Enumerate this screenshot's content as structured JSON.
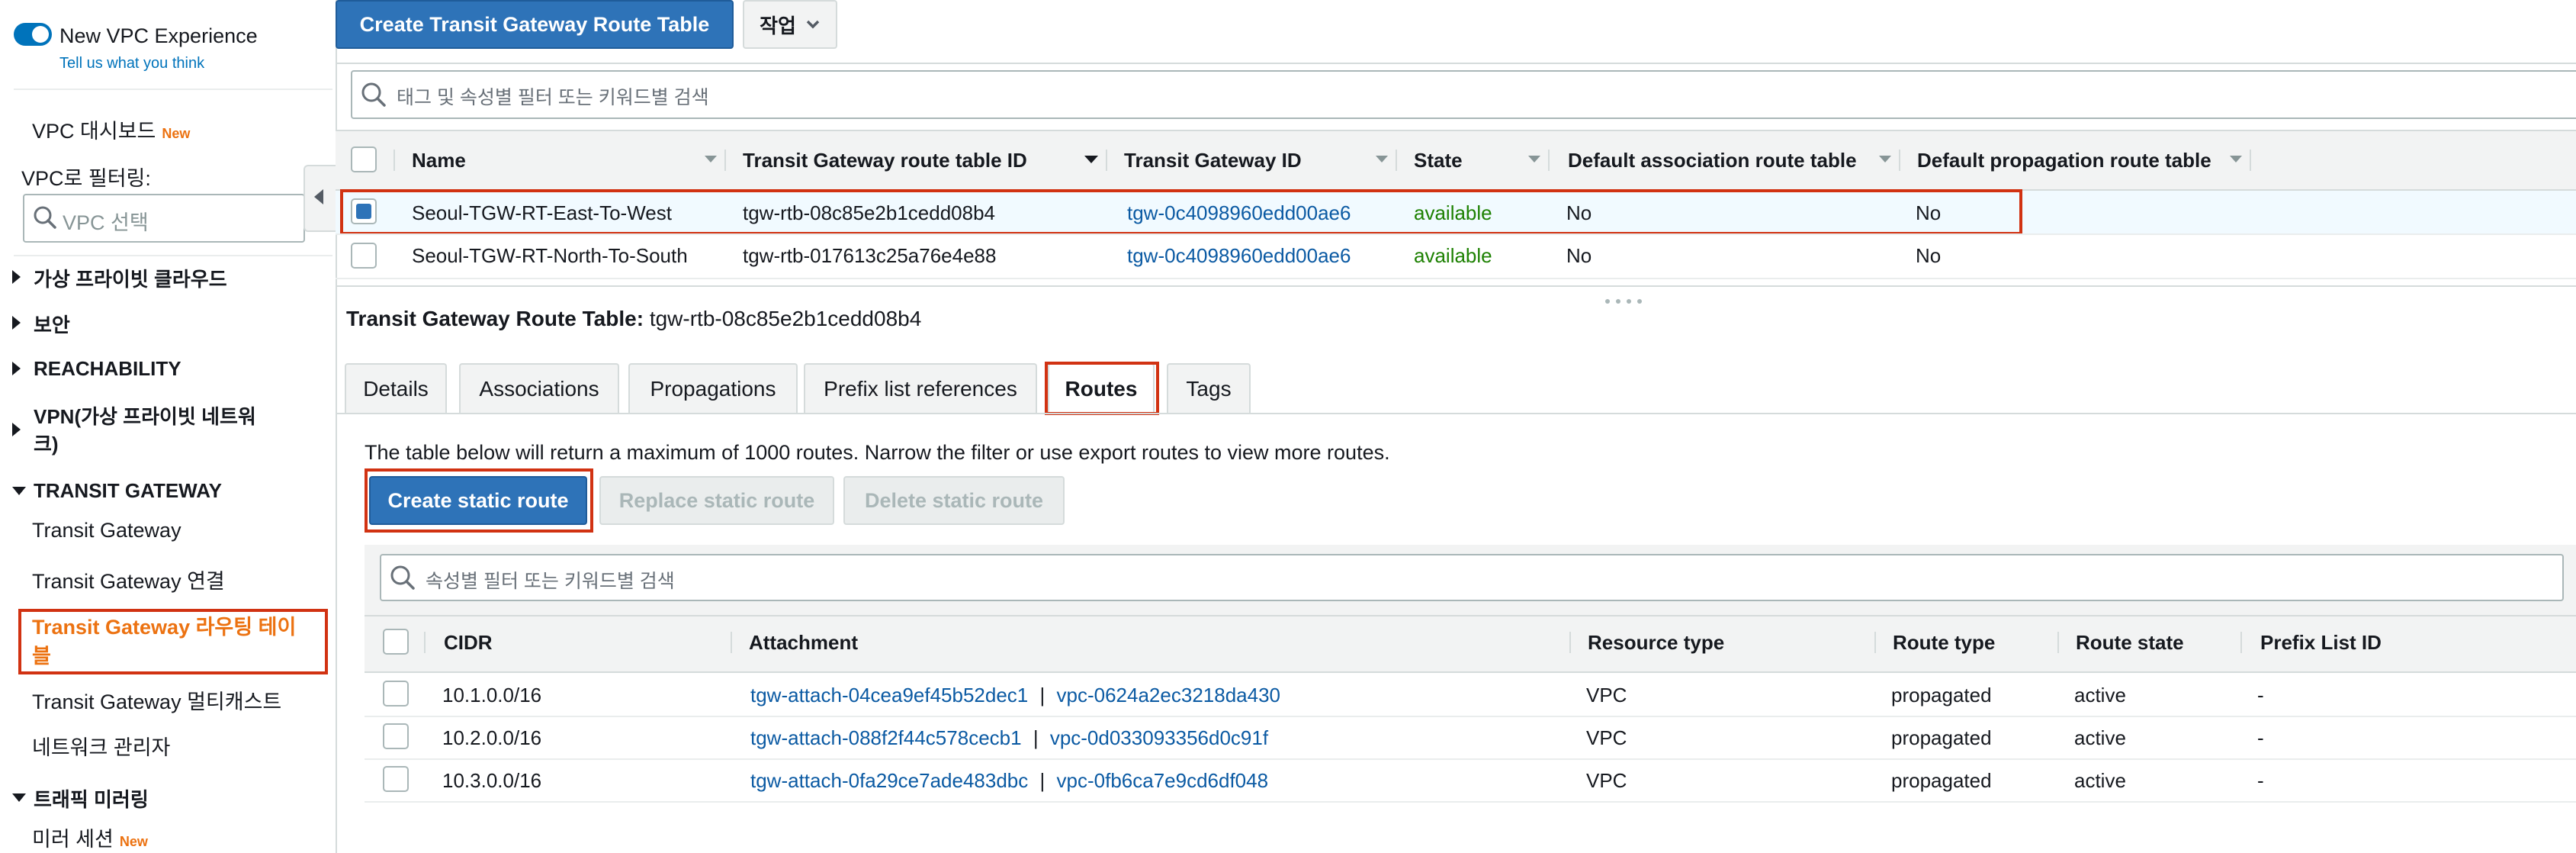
{
  "sidebar": {
    "new_vpc_label": "New VPC Experience",
    "feedback_link": "Tell us what you think",
    "dashboard_label": "VPC 대시보드",
    "new_badge": "New",
    "filter_label": "VPC로 필터링:",
    "filter_placeholder": "VPC 선택",
    "sections": {
      "private_cloud": "가상 프라이빗 클라우드",
      "security": "보안",
      "reachability": "REACHABILITY",
      "vpn_line1": "VPN(가상 프라이빗 네트워",
      "vpn_line2": "크)",
      "transit_gateway": "TRANSIT GATEWAY",
      "traffic_mirroring": "트래픽 미러링"
    },
    "tgw_items": {
      "transit_gateway": "Transit Gateway",
      "attachments": "Transit Gateway 연결",
      "route_tables_line1": "Transit Gateway 라우팅 테이",
      "route_tables_line2": "블",
      "multicast": "Transit Gateway 멀티캐스트",
      "network_manager": "네트워크 관리자"
    },
    "mirror_session": "미러 세션"
  },
  "toolbar": {
    "create_button": "Create Transit Gateway Route Table",
    "actions_button": "작업"
  },
  "top_search": {
    "placeholder": "태그 및 속성별 필터 또는 키워드별 검색"
  },
  "route_tables": {
    "columns": [
      "Name",
      "Transit Gateway route table ID",
      "Transit Gateway ID",
      "State",
      "Default association route table",
      "Default propagation route table"
    ],
    "rows": [
      {
        "name": "Seoul-TGW-RT-East-To-West",
        "rt_id": "tgw-rtb-08c85e2b1cedd08b4",
        "tgw_id": "tgw-0c4098960edd00ae6",
        "state": "available",
        "assoc": "No",
        "prop": "No",
        "selected": true
      },
      {
        "name": "Seoul-TGW-RT-North-To-South",
        "rt_id": "tgw-rtb-017613c25a76e4e88",
        "tgw_id": "tgw-0c4098960edd00ae6",
        "state": "available",
        "assoc": "No",
        "prop": "No",
        "selected": false
      }
    ]
  },
  "detail": {
    "title_label": "Transit Gateway Route Table:",
    "title_value": "tgw-rtb-08c85e2b1cedd08b4",
    "tabs": [
      "Details",
      "Associations",
      "Propagations",
      "Prefix list references",
      "Routes",
      "Tags"
    ],
    "active_tab": "Routes",
    "notice": "The table below will return a maximum of 1000 routes. Narrow the filter or use export routes to view more routes.",
    "create_static_route": "Create static route",
    "replace_static_route": "Replace static route",
    "delete_static_route": "Delete static route",
    "search_placeholder": "속성별 필터 또는 키워드별 검색"
  },
  "routes": {
    "columns": [
      "CIDR",
      "Attachment",
      "Resource type",
      "Route type",
      "Route state",
      "Prefix List ID"
    ],
    "rows": [
      {
        "cidr": "10.1.0.0/16",
        "attach": "tgw-attach-04cea9ef45b52dec1",
        "sep": "|",
        "vpc": "vpc-0624a2ec3218da430",
        "type": "VPC",
        "route_type": "propagated",
        "state": "active",
        "prefix": "-"
      },
      {
        "cidr": "10.2.0.0/16",
        "attach": "tgw-attach-088f2f44c578cecb1",
        "sep": "|",
        "vpc": "vpc-0d033093356d0c91f",
        "type": "VPC",
        "route_type": "propagated",
        "state": "active",
        "prefix": "-"
      },
      {
        "cidr": "10.3.0.0/16",
        "attach": "tgw-attach-0fa29ce7ade483dbc",
        "sep": "|",
        "vpc": "vpc-0fb6ca7e9cd6df048",
        "type": "VPC",
        "route_type": "propagated",
        "state": "active",
        "prefix": "-"
      }
    ]
  },
  "colors": {
    "primary": "#2e73b8",
    "link": "#0b5aa3",
    "available": "#1d8102",
    "highlight": "#d13212",
    "new_badge": "#ec7211"
  }
}
